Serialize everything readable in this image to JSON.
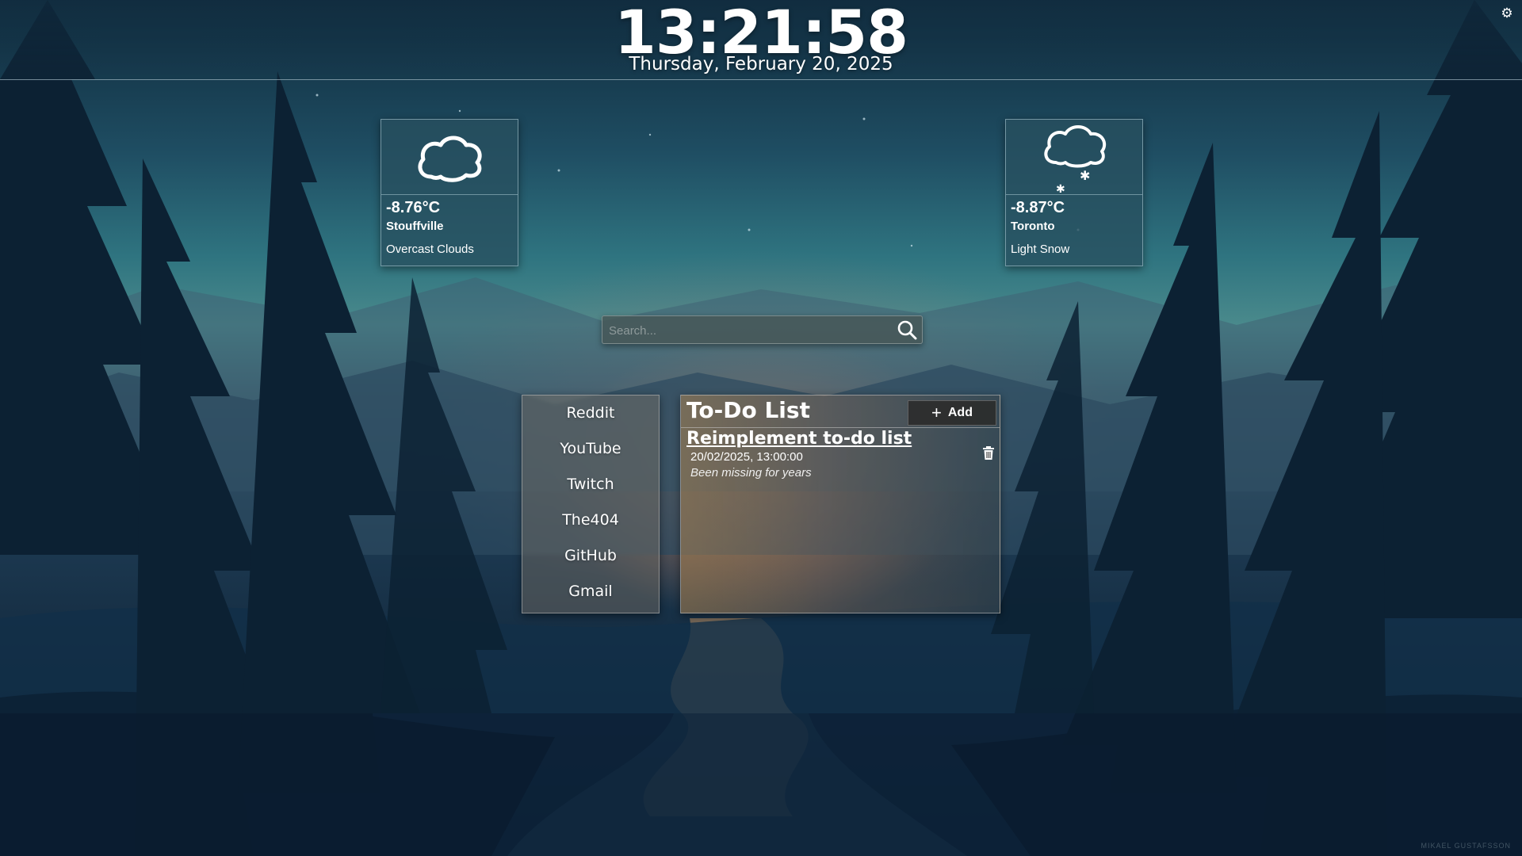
{
  "clock": {
    "time": "13:21:58",
    "date": "Thursday, February 20, 2025"
  },
  "settings": {
    "icon": "gear-icon"
  },
  "weather": [
    {
      "temp": "-8.76°C",
      "city": "Stouffville",
      "condition": "Overcast Clouds",
      "icon": "cloud-icon"
    },
    {
      "temp": "-8.87°C",
      "city": "Toronto",
      "condition": "Light Snow",
      "icon": "snow-cloud-icon"
    }
  ],
  "search": {
    "placeholder": "Search...",
    "icon": "search-icon"
  },
  "links": [
    "Reddit",
    "YouTube",
    "Twitch",
    "The404",
    "GitHub",
    "Gmail"
  ],
  "todo": {
    "title": "To-Do List",
    "add_label": "Add",
    "items": [
      {
        "title": "Reimplement to-do list",
        "date": "20/02/2025, 13:00:00",
        "note": "Been missing for years"
      }
    ]
  },
  "credit": "MIKAEL GUSTAFSSON"
}
